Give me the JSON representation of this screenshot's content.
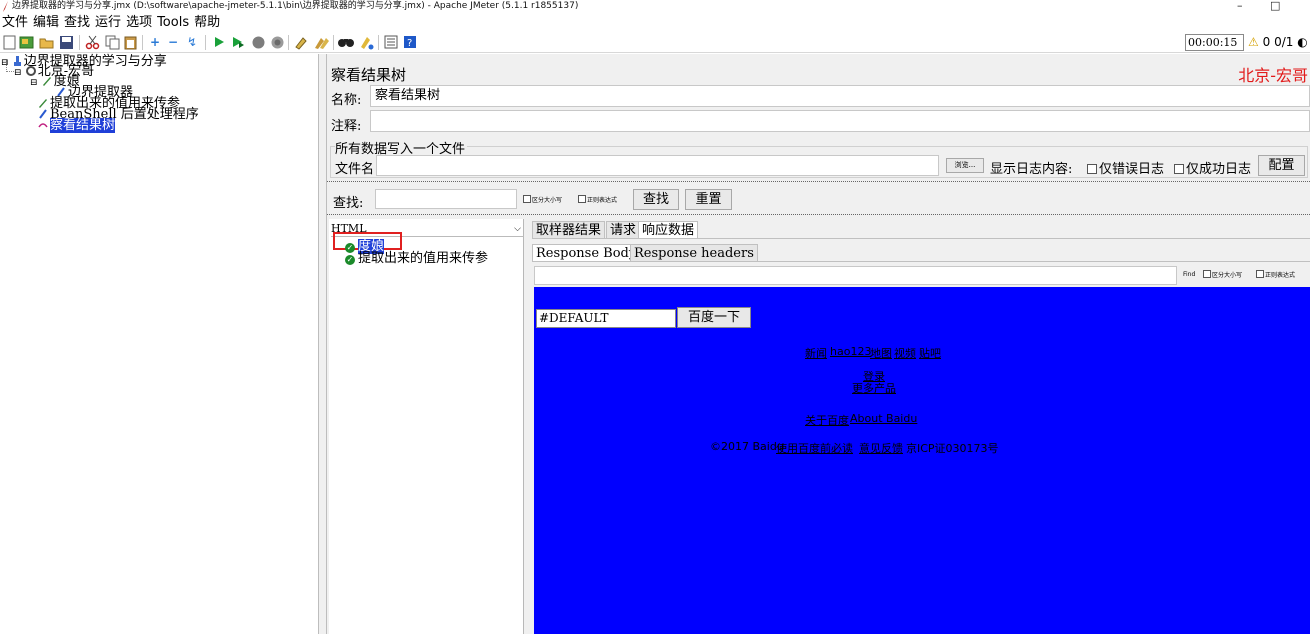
{
  "window": {
    "title": "边界提取器的学习与分享.jmx (D:\\software\\apache-jmeter-5.1.1\\bin\\边界提取器的学习与分享.jmx) - Apache JMeter (5.1.1 r1855137)",
    "minimize": "–",
    "maximize": "□"
  },
  "menu": [
    "文件",
    "编辑",
    "查找",
    "运行",
    "选项",
    "Tools",
    "帮助"
  ],
  "toolbar": {
    "timer": "00:00:15",
    "warn_icon": "warning-triangle-icon",
    "warn_count": "0",
    "threads": "0/1"
  },
  "tree": {
    "root": "边界提取器的学习与分享",
    "thread_group": "北京-宏哥",
    "sampler": "度娘",
    "extractor": "边界提取器",
    "sampler2": "提取出来的值用来传参",
    "postproc": "BeanShell 后置处理程序",
    "listener": "察看结果树"
  },
  "panel": {
    "title": "察看结果树",
    "brand": "北京-宏哥",
    "name_label": "名称:",
    "name_value": "察看结果树",
    "comment_label": "注释:",
    "file_group": "所有数据写入一个文件",
    "filename_label": "文件名",
    "browse": "浏览...",
    "log_label": "显示日志内容:",
    "errors_only": "仅错误日志",
    "success_only": "仅成功日志",
    "configure": "配置",
    "search_label": "查找:",
    "case_sensitive": "区分大小写",
    "regex": "正则表达式",
    "search_btn": "查找",
    "reset_btn": "重置"
  },
  "results": {
    "renderer": "HTML",
    "items": [
      "度娘",
      "提取出来的值用来传参"
    ]
  },
  "tabs": [
    "取样器结果",
    "请求",
    "响应数据"
  ],
  "subtabs": [
    "Response Body",
    "Response headers"
  ],
  "find": {
    "label": "Find",
    "case": "区分大小写",
    "regex": "正则表达式"
  },
  "viewer": {
    "input_value": "#DEFAULT",
    "button": "百度一下",
    "links1": [
      "新闻",
      "hao123",
      "地图",
      "视频",
      "贴吧"
    ],
    "login": "登录",
    "more": "更多产品",
    "about": "关于百度",
    "about_en": "About Baidu",
    "copyright": "©2017 Baidu",
    "must_read": "使用百度前必读",
    "feedback": "意见反馈",
    "icp": "京ICP证030173号"
  }
}
